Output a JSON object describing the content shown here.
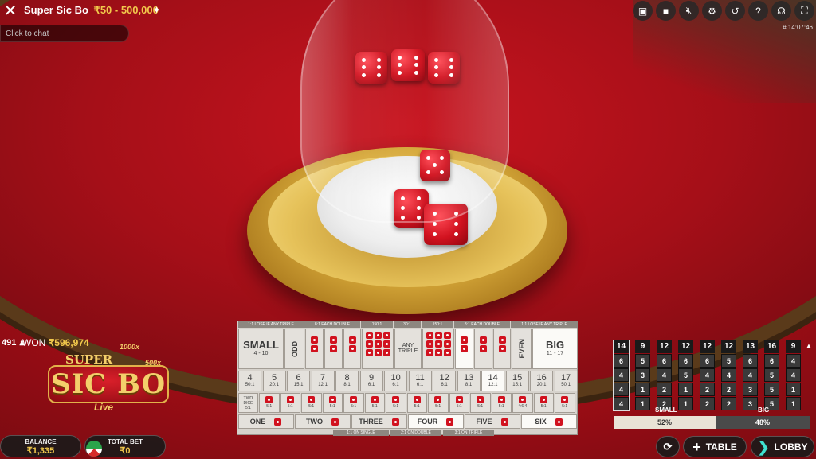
{
  "header": {
    "title": "Super Sic Bo",
    "limit": "₹50 - 500,000",
    "chat_placeholder": "Click to chat",
    "round_id": "# 14:07:46",
    "icons": [
      "chat-icon",
      "video-icon",
      "mute-icon",
      "settings-icon",
      "history-icon",
      "help-icon",
      "support-icon",
      "fullscreen-icon"
    ]
  },
  "stats": {
    "players": "491",
    "won_label": "WON",
    "won_amount": "₹596,974"
  },
  "logo": {
    "super": "SUPER",
    "name": "SIC BO",
    "live": "Live",
    "m1000": "1000x",
    "m500": "500x"
  },
  "bottom": {
    "balance_label": "BALANCE",
    "balance": "₹1,335",
    "total_bet_label": "TOTAL BET",
    "total_bet": "₹0",
    "table_label": "TABLE",
    "lobby_label": "LOBBY"
  },
  "bet_table": {
    "headers": {
      "lose_triple_l": "1:1 LOSE IF ANY TRIPLE",
      "each_double_l": "8:1 EACH DOUBLE",
      "triple_l": "150:1",
      "any_triple_pay": "30:1",
      "triple_r": "150:1",
      "each_double_r": "8:1 EACH DOUBLE",
      "lose_triple_r": "1:1 LOSE IF ANY TRIPLE"
    },
    "small": "SMALL",
    "small_range": "4 - 10",
    "odd": "ODD",
    "any_triple": "ANY TRIPLE",
    "even": "EVEN",
    "big": "BIG",
    "big_range": "11 - 17",
    "totals": [
      {
        "n": "4",
        "p": "50:1"
      },
      {
        "n": "5",
        "p": "20:1"
      },
      {
        "n": "6",
        "p": "15:1"
      },
      {
        "n": "7",
        "p": "12:1"
      },
      {
        "n": "8",
        "p": "8:1"
      },
      {
        "n": "9",
        "p": "6:1"
      },
      {
        "n": "10",
        "p": "6:1"
      },
      {
        "n": "11",
        "p": "6:1"
      },
      {
        "n": "12",
        "p": "6:1"
      },
      {
        "n": "13",
        "p": "8:1"
      },
      {
        "n": "14",
        "p": "12:1"
      },
      {
        "n": "15",
        "p": "15:1"
      },
      {
        "n": "16",
        "p": "20:1"
      },
      {
        "n": "17",
        "p": "50:1"
      }
    ],
    "two_dice": "TWO DICE",
    "two_dice_pay": "5:1",
    "combos": [
      "1 2",
      "1 3",
      "1 4",
      "1 5",
      "1 6",
      "2 3",
      "2 4",
      "2 5",
      "2 6",
      "3 4",
      "3 5",
      "3 6",
      "4 5",
      "4 6",
      "5 6"
    ],
    "combo_pays": [
      "5:1",
      "5:1",
      "5:1",
      "5:1",
      "5:1",
      "5:1",
      "5:1",
      "5:1",
      "5:1",
      "5:1",
      "5:1",
      "5:1",
      "4:6:4",
      "5:1",
      "5:1"
    ],
    "singles": [
      "ONE",
      "TWO",
      "THREE",
      "FOUR",
      "FIVE",
      "SIX"
    ],
    "footer": {
      "single": "1:1 ON SINGLE",
      "double": "2:1 ON DOUBLE",
      "triple": "3:1 ON TRIPLE"
    }
  },
  "history": [
    {
      "total": "14",
      "red": false,
      "dice": [
        "6",
        "4",
        "4",
        "4"
      ]
    },
    {
      "total": "9",
      "red": false,
      "dice": [
        "5",
        "3",
        "1",
        "1"
      ]
    },
    {
      "total": "12",
      "red": false,
      "dice": [
        "6",
        "4",
        "2",
        "2"
      ]
    },
    {
      "total": "12",
      "red": false,
      "dice": [
        "6",
        "5",
        "1",
        "1"
      ]
    },
    {
      "total": "12",
      "red": false,
      "dice": [
        "6",
        "4",
        "2",
        "2"
      ]
    },
    {
      "total": "12",
      "red": false,
      "dice": [
        "5",
        "4",
        "2",
        "2"
      ]
    },
    {
      "total": "13",
      "red": false,
      "dice": [
        "6",
        "4",
        "3",
        "3"
      ]
    },
    {
      "total": "16",
      "red": false,
      "dice": [
        "6",
        "5",
        "5",
        "5"
      ]
    },
    {
      "total": "9",
      "red": false,
      "dice": [
        "4",
        "4",
        "1",
        "1"
      ]
    }
  ],
  "small_big": {
    "small_label": "SMALL",
    "big_label": "BIG",
    "small_pct": "52%",
    "big_pct": "48%",
    "small_fraction": 0.52
  },
  "colors": {
    "accent_gold": "#f2c94c",
    "felt_red": "#b5121b",
    "die_red": "#d1121f",
    "lobby_teal": "#3fe0d0"
  }
}
